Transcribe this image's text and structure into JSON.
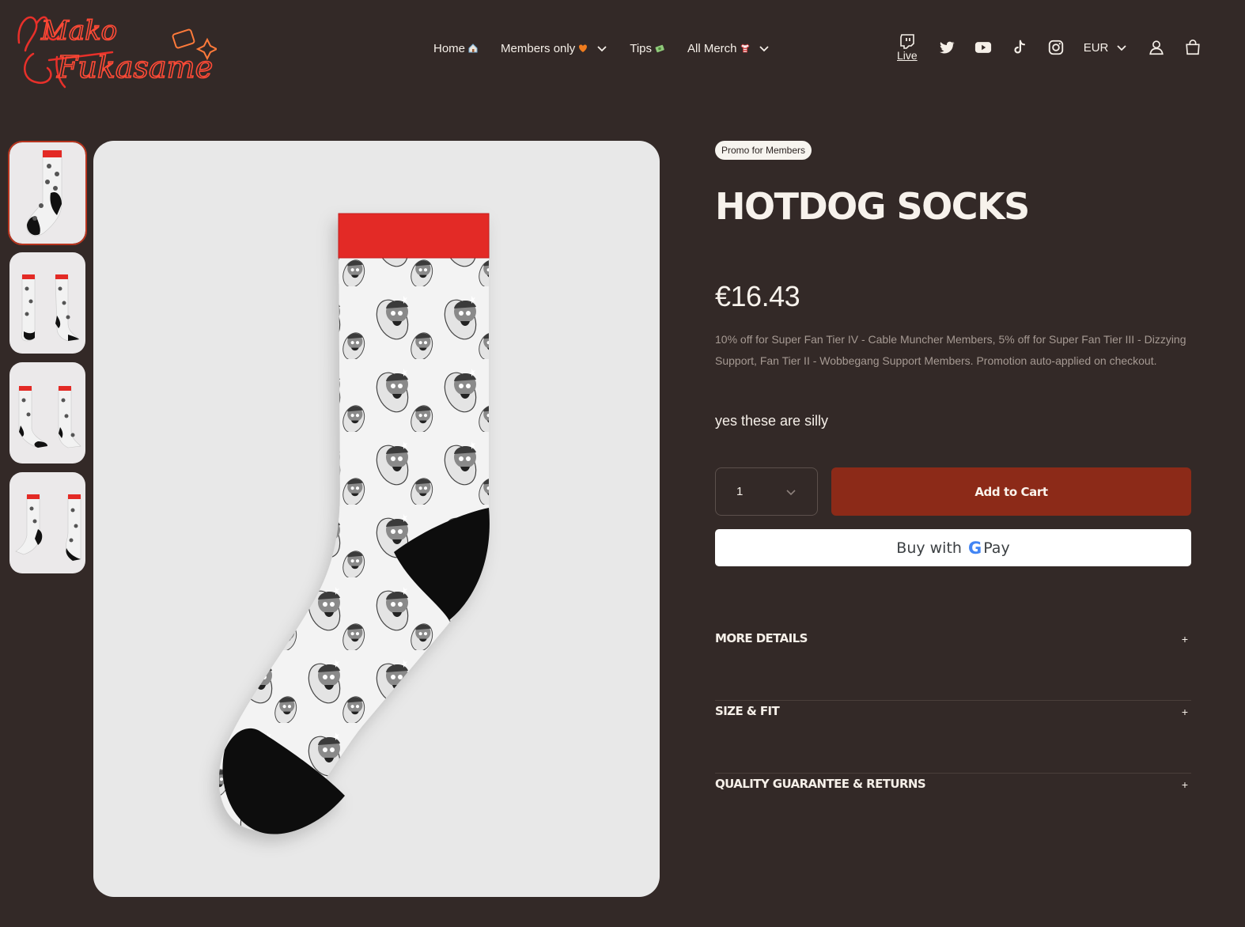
{
  "header": {
    "logo_text_line1": "Mako",
    "logo_text_line2": "Fukasame",
    "nav": [
      {
        "label": "Home",
        "emoji": "house",
        "has_dropdown": false
      },
      {
        "label": "Members only",
        "emoji": "orange-heart",
        "has_dropdown": true
      },
      {
        "label": "Tips",
        "emoji": "money",
        "has_dropdown": false
      },
      {
        "label": "All Merch",
        "emoji": "shirt",
        "has_dropdown": true
      }
    ],
    "live_label": "Live",
    "currency": "EUR",
    "icons": [
      "twitch-icon",
      "twitter-icon",
      "youtube-icon",
      "tiktok-icon",
      "instagram-icon",
      "account-icon",
      "cart-icon"
    ]
  },
  "gallery": {
    "thumbnail_count": 4,
    "active_index": 0
  },
  "product": {
    "badge": "Promo for Members",
    "title": "HOTDOG SOCKS",
    "price": "€16.43",
    "promo_text": "10% off for Super Fan Tier IV - Cable Muncher Members, 5% off for Super Fan Tier III - Dizzying Support, Fan Tier II - Wobbegang Support Members. Promotion auto-applied on checkout.",
    "description": "yes these are silly",
    "quantity": "1",
    "add_to_cart": "Add to Cart",
    "gpay_prefix": "Buy with",
    "gpay_g": "G",
    "gpay_pay": "Pay"
  },
  "accordion": [
    {
      "label": "MORE DETAILS",
      "icon": "+"
    },
    {
      "label": "SIZE & FIT",
      "icon": "+"
    },
    {
      "label": "QUALITY GUARANTEE & RETURNS",
      "icon": "+"
    }
  ],
  "colors": {
    "background": "#332927",
    "accent_button": "#8c2a18",
    "sock_cuff": "#e32a25",
    "sock_heel": "#111111"
  }
}
